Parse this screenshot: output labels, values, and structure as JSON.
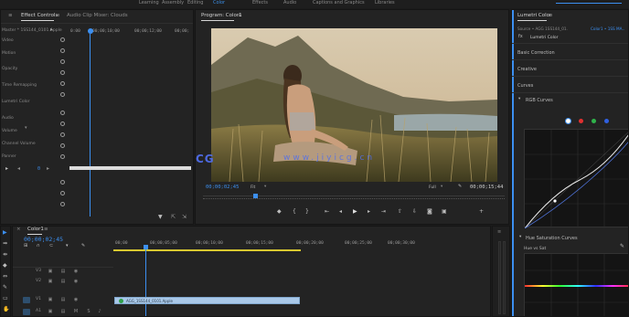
{
  "workspaces": [
    "Learning",
    "Assembly",
    "Editing",
    "Color",
    "Effects",
    "Audio",
    "Captions and Graphics",
    "Libraries"
  ],
  "active_workspace": "Color",
  "effect_controls": {
    "tab_label": "Effect Controls",
    "tab2_label": "Audio Clip Mixer: Clouds",
    "clip_label": "Master * 1SS144_0101.Apple",
    "ruler_start": "0:00",
    "ruler_mid": "00;00;10;00",
    "ruler_mid2": "00;00;12;00",
    "ruler_end": "00;00;",
    "row_labels": [
      "Video",
      "Motion",
      "Opacity",
      "Time Remapping",
      "Lumetri Color",
      "Audio",
      "Volume",
      "Channel Volume",
      "Panner"
    ],
    "timecode_small": "0"
  },
  "program": {
    "tab_label": "Program: Color1",
    "timecode": "00;00;02;45",
    "fit": "Fit",
    "quality": "Full",
    "duration": "00;00;15;44",
    "watermark_main": "技艺CG",
    "watermark_url": "www.jiyicg.cn"
  },
  "lumetri": {
    "tab_label": "Lumetri Color",
    "source_label": "Source • AGG 1SS144_01.",
    "target_label": "Color1 • 1SS MA..",
    "fx_label": "Lumetri Color",
    "sections": [
      "Basic Correction",
      "Creative",
      "Curves"
    ],
    "rgb_curves": "RGB Curves",
    "hue_sat": "Hue Saturation Curves",
    "hue_vs_sat": "Hue vs Sat",
    "curve_colors": [
      "#ffffff",
      "#e23030",
      "#2fb34a",
      "#3060e0"
    ]
  },
  "timeline": {
    "tab_label": "Color1",
    "timecode": "00;00;02;45",
    "ruler": [
      "00;00",
      "00;00;05;00",
      "00;00;10;00",
      "00;00;15;00",
      "00;00;20;00",
      "00;00;25;00",
      "00;00;30;00"
    ],
    "tracks": [
      "V3",
      "V2",
      "V1",
      "A1",
      "A2"
    ],
    "clip_label": "AGG_1SS144_0101.Apple"
  },
  "colors": {
    "accent": "#3c8ff0",
    "clip": "#a9c8e8",
    "work_area": "#d8c830"
  }
}
